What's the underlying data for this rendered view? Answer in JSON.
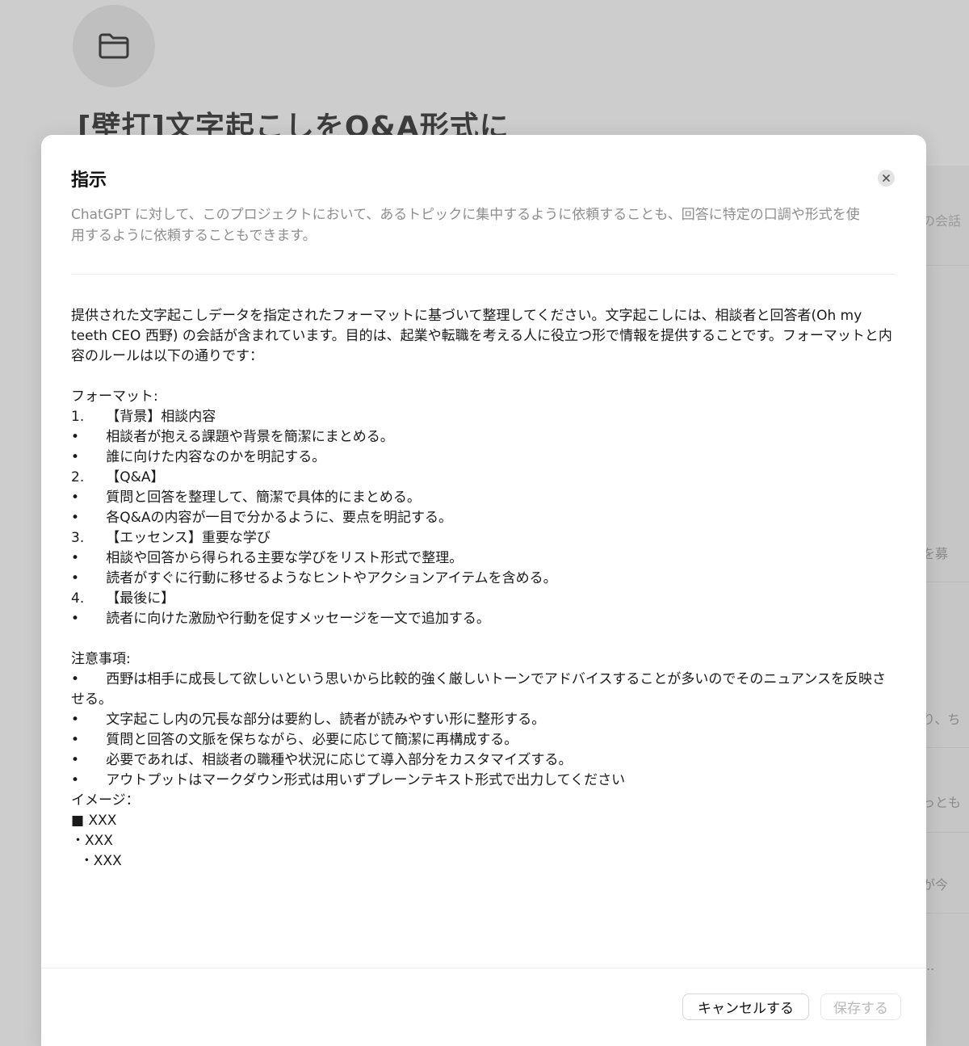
{
  "background": {
    "project_title": "[壁打]文字起こしをQ&A形式に",
    "snippets": [
      {
        "text": "の会話"
      },
      {
        "text": "を募"
      },
      {
        "text": "り、ち"
      },
      {
        "text": "っとも"
      },
      {
        "text": "が今"
      },
      {
        "text": "..."
      }
    ]
  },
  "modal": {
    "title": "指示",
    "description": "ChatGPT に対して、このプロジェクトにおいて、あるトピックに集中するように依頼することも、回答に特定の口調や形式を使用するように依頼することもできます。",
    "instructions": "提供された文字起こしデータを指定されたフォーマットに基づいて整理してください。文字起こしには、相談者と回答者(Oh my teeth CEO 西野) の会話が含まれています。目的は、起業や転職を考える人に役立つ形で情報を提供することです。フォーマットと内容のルールは以下の通りです：\n\nフォーマット:\n1.\t【背景】相談内容\n•\t相談者が抱える課題や背景を簡潔にまとめる。\n•\t誰に向けた内容なのかを明記する。\n2.\t【Q&A】\n•\t質問と回答を整理して、簡潔で具体的にまとめる。\n•\t各Q&Aの内容が一目で分かるように、要点を明記する。\n3.\t【エッセンス】重要な学び\n•\t相談や回答から得られる主要な学びをリスト形式で整理。\n•\t読者がすぐに行動に移せるようなヒントやアクションアイテムを含める。\n4.\t【最後に】\n•\t読者に向けた激励や行動を促すメッセージを一文で追加する。\n\n注意事項:\n•\t西野は相手に成長して欲しいという思いから比較的強く厳しいトーンでアドバイスすることが多いのでそのニュアンスを反映させる。\n•\t文字起こし内の冗長な部分は要約し、読者が読みやすい形に整形する。\n•\t質問と回答の文脈を保ちながら、必要に応じて簡潔に再構成する。\n•\t必要であれば、相談者の職種や状況に応じて導入部分をカスタマイズする。\n•\tアウトプットはマークダウン形式は用いずプレーンテキスト形式で出力してください\nイメージ：\n■ XXX\n・XXX\n  ・XXX",
    "cancel_label": "キャンセルする",
    "save_label": "保存する"
  }
}
